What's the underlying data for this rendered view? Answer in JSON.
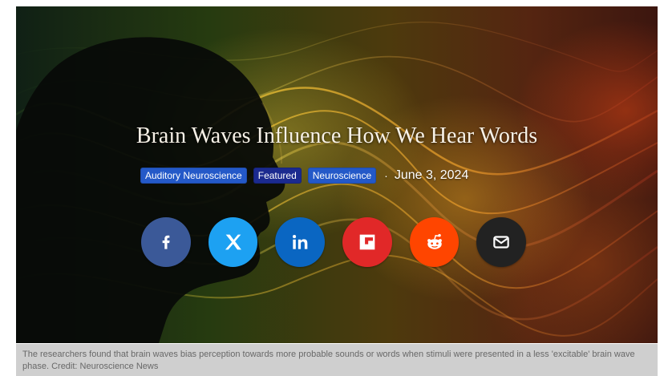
{
  "article": {
    "title": "Brain Waves Influence How We Hear Words",
    "tags": [
      {
        "label": "Auditory Neuroscience",
        "color": "#2459c8"
      },
      {
        "label": "Featured",
        "color": "#1b2a8f"
      },
      {
        "label": "Neuroscience",
        "color": "#2459c8"
      }
    ],
    "separator": "·",
    "date": "June 3, 2024"
  },
  "share_buttons": [
    {
      "icon": "facebook-icon",
      "color": "#3b5998"
    },
    {
      "icon": "x-icon",
      "color": "#1da1f2"
    },
    {
      "icon": "linkedin-icon",
      "color": "#0a66c2"
    },
    {
      "icon": "flipboard-icon",
      "color": "#e12828"
    },
    {
      "icon": "reddit-icon",
      "color": "#ff4500"
    },
    {
      "icon": "email-icon",
      "color": "#222222"
    }
  ],
  "caption": {
    "text": "The researchers found that brain waves bias perception towards more probable sounds or words when stimuli were presented in a less 'excitable' brain wave phase. Credit: Neuroscience News"
  }
}
